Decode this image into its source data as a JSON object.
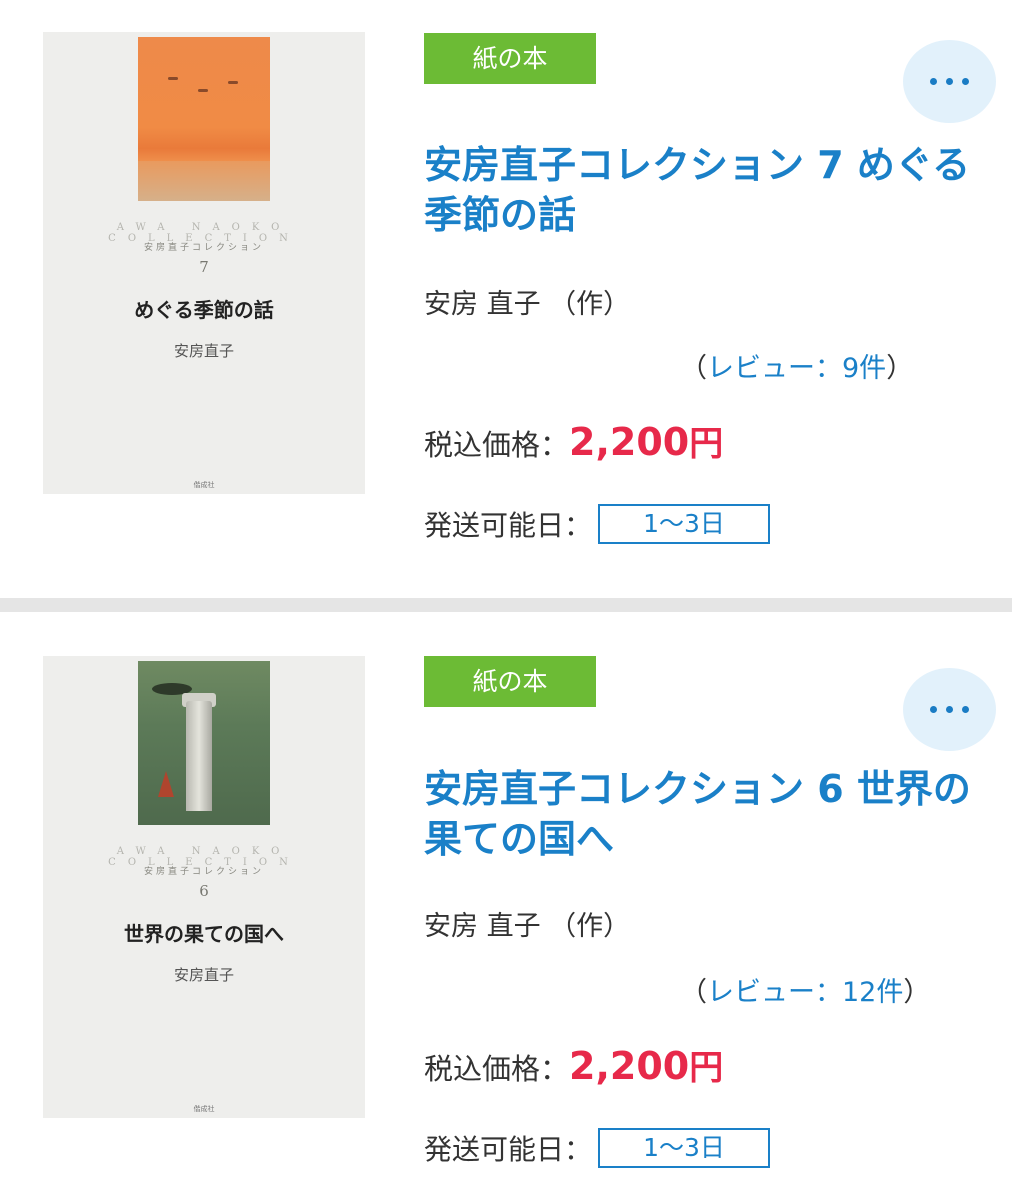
{
  "items": [
    {
      "badge": "紙の本",
      "title": "安房直子コレクション 7 めぐる季節の話",
      "author": "安房 直子 （作）",
      "review_open": "（",
      "review_link": "レビュー：9件",
      "review_close": "）",
      "price_label": "税込価格：",
      "price_amount": "2,200",
      "price_unit": "円",
      "ship_label": "発送可能日：",
      "ship_value": "1〜3日",
      "cover": {
        "series": "AWA NAOKO COLLECTION",
        "series_jp": "安房直子コレクション",
        "volume": "7",
        "title": "めぐる季節の話",
        "author": "安房直子",
        "publisher": "偕成社"
      }
    },
    {
      "badge": "紙の本",
      "title": "安房直子コレクション 6 世界の果ての国へ",
      "author": "安房 直子 （作）",
      "review_open": "（",
      "review_link": "レビュー：12件",
      "review_close": "）",
      "price_label": "税込価格：",
      "price_amount": "2,200",
      "price_unit": "円",
      "ship_label": "発送可能日：",
      "ship_value": "1〜3日",
      "cover": {
        "series": "AWA NAOKO COLLECTION",
        "series_jp": "安房直子コレクション",
        "volume": "6",
        "title": "世界の果ての国へ",
        "author": "安房直子",
        "publisher": "偕成社"
      }
    }
  ],
  "icons": {
    "more": "more-horizontal-icon"
  },
  "colors": {
    "badge_bg": "#6cbb35",
    "link": "#1a80c8",
    "price": "#e7294a",
    "more_bg": "#e2f1fb",
    "divider": "#e5e5e5"
  }
}
